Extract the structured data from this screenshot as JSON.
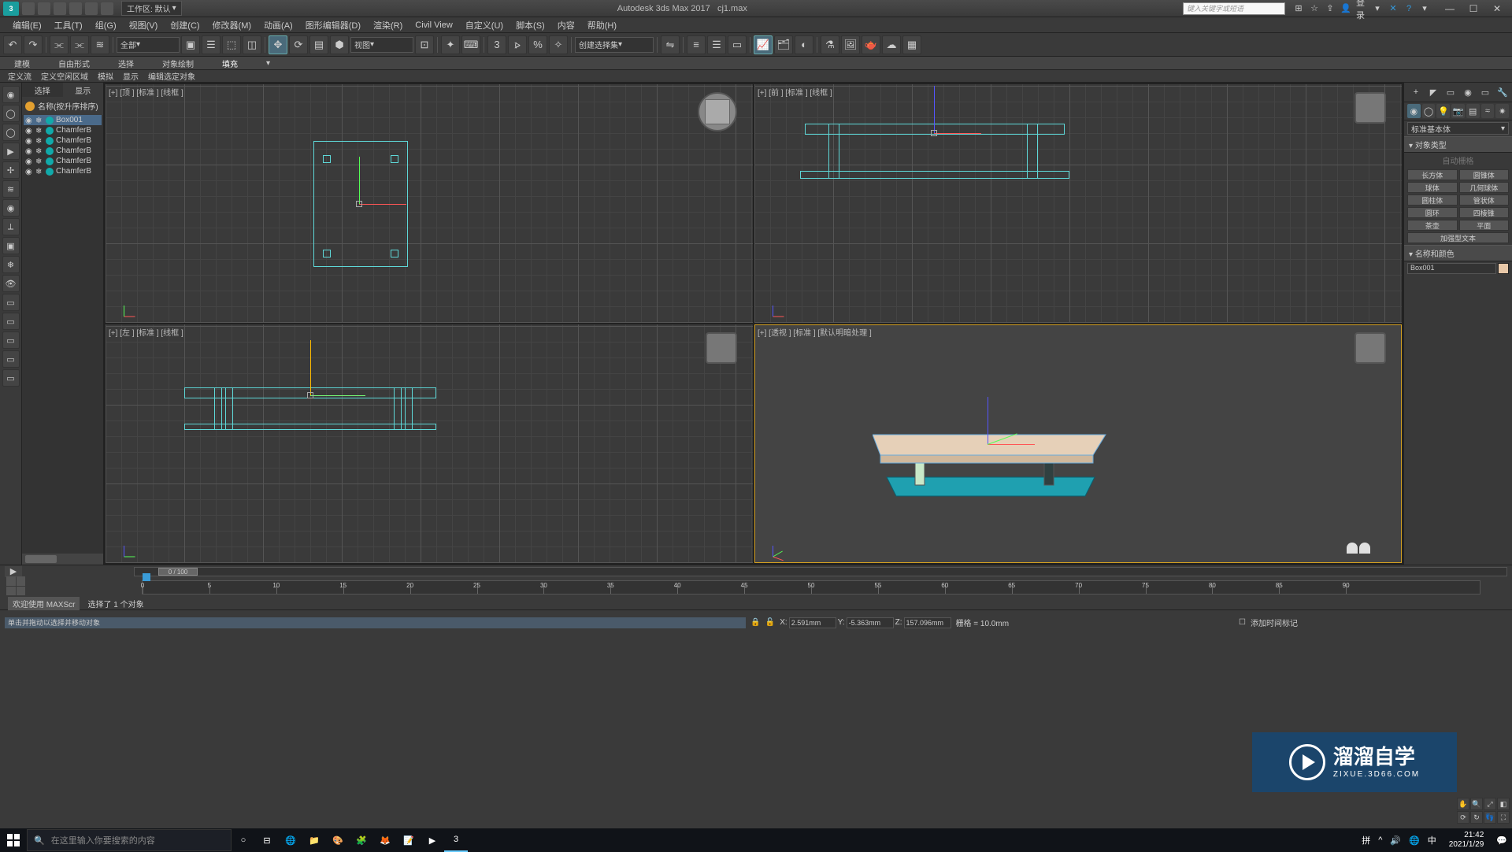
{
  "titlebar": {
    "logo_text": "3",
    "workspace_label": "工作区: 默认",
    "app_title": "Autodesk 3ds Max 2017",
    "filename": "cj1.max",
    "search_placeholder": "键入关键字或短语",
    "login_label": "登录"
  },
  "menubar": {
    "items": [
      "编辑(E)",
      "工具(T)",
      "组(G)",
      "视图(V)",
      "创建(C)",
      "修改器(M)",
      "动画(A)",
      "图形编辑器(D)",
      "渲染(R)",
      "Civil View",
      "自定义(U)",
      "脚本(S)",
      "内容",
      "帮助(H)"
    ]
  },
  "maintoolbar": {
    "filter_dd": "全部",
    "view_dd": "视图",
    "selset_dd": "创建选择集"
  },
  "ribbon": {
    "tabs": [
      "建模",
      "自由形式",
      "选择",
      "对象绘制",
      "填充"
    ]
  },
  "ribbon2": {
    "items": [
      "定义流",
      "定义空闲区域",
      "模拟",
      "显示",
      "编辑选定对象"
    ]
  },
  "scene_explorer": {
    "tab_select": "选择",
    "tab_display": "显示",
    "header": "名称(按升序排序)",
    "items": [
      {
        "name": "Box001",
        "selected": true
      },
      {
        "name": "ChamferB",
        "selected": false
      },
      {
        "name": "ChamferB",
        "selected": false
      },
      {
        "name": "ChamferB",
        "selected": false
      },
      {
        "name": "ChamferB",
        "selected": false
      },
      {
        "name": "ChamferB",
        "selected": false
      }
    ]
  },
  "viewports": {
    "top": "[+] [顶 ] [标准 ] [线框 ]",
    "front": "[+] [前 ] [标准 ] [线框 ]",
    "left": "[+] [左 ] [标准 ] [线框 ]",
    "persp": "[+] [透视 ] [标准 ] [默认明暗处理 ]"
  },
  "cmdpanel": {
    "dropdown": "标准基本体",
    "rollout_obj_type": "对象类型",
    "autogrid": "自动栅格",
    "primitives": [
      "长方体",
      "圆锥体",
      "球体",
      "几何球体",
      "圆柱体",
      "管状体",
      "圆环",
      "四棱锥",
      "茶壶",
      "平面",
      "加强型文本",
      ""
    ],
    "rollout_name": "名称和颜色",
    "object_name": "Box001"
  },
  "timeline": {
    "slider": "0 / 100",
    "ticks": [
      0,
      5,
      10,
      15,
      20,
      25,
      30,
      35,
      40,
      45,
      50,
      55,
      60,
      65,
      70,
      75,
      80,
      85,
      90
    ]
  },
  "statusbar": {
    "welcome": "欢迎使用 MAXScr",
    "selection": "选择了 1 个对象",
    "prompt": "单击并拖动以选择并移动对象",
    "x_val": "2.591mm",
    "y_val": "-5.363mm",
    "z_val": "157.096mm",
    "grid_label": "栅格 = 10.0mm",
    "add_time_tag": "添加时间标记"
  },
  "watermark": {
    "main": "溜溜自学",
    "sub": "ZIXUE.3D66.COM"
  },
  "taskbar": {
    "search_placeholder": "在这里输入你要搜索的内容",
    "time": "21:42",
    "date": "2021/1/29"
  }
}
